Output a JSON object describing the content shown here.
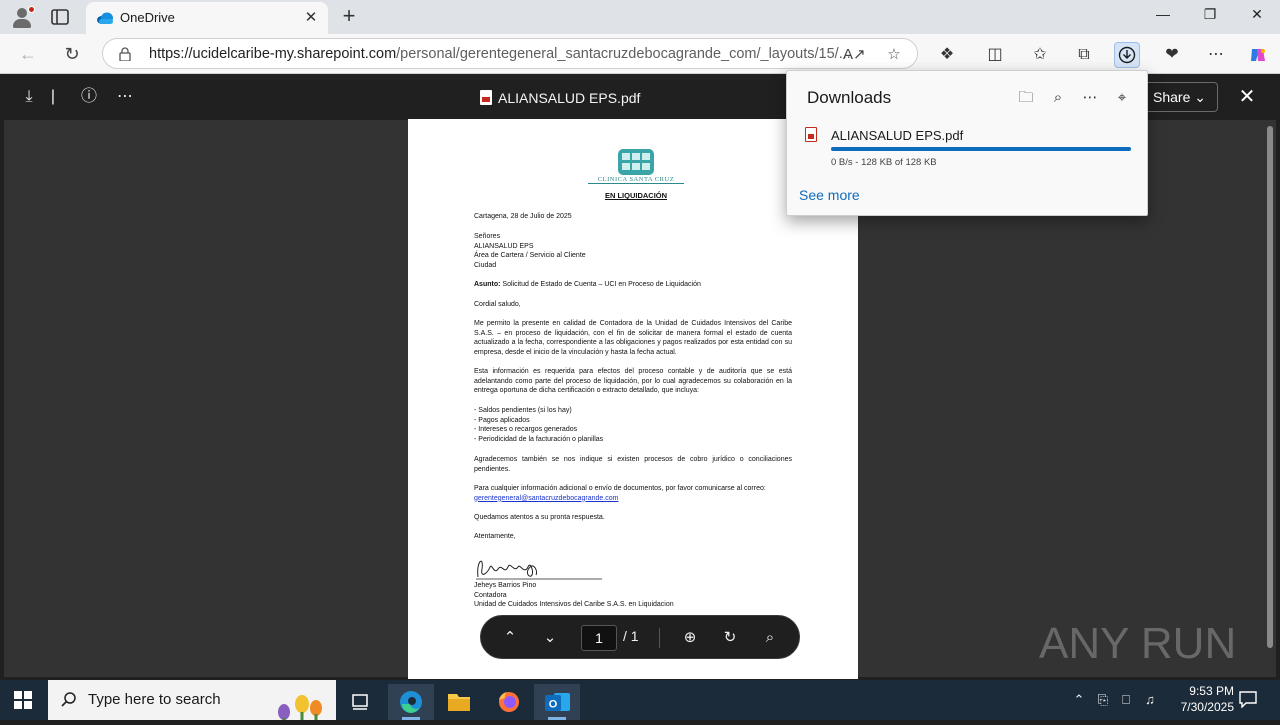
{
  "browser": {
    "tab_title": "OneDrive",
    "new_tab_label": "+",
    "url_host": "https://ucidelcaribe-my.sharepoint.com",
    "url_path": "/personal/gerentegeneral_santacruzdebocagrande_com/_layouts/15/...",
    "window_controls": {
      "minimize": "—",
      "maximize": "❐",
      "close": "✕"
    }
  },
  "viewer": {
    "file_name": "ALIANSALUD EPS.pdf",
    "share_label": "Share",
    "page_current": "1",
    "page_total": "/ 1"
  },
  "document": {
    "logo_text": "CLINICA SANTA CRUZ",
    "heading": "EN LIQUIDACIÓN",
    "date_line": "Cartagena, 28 de Julio de 2025",
    "recipient": [
      "Señores",
      "ALIANSALUD EPS",
      "Área de Cartera / Servicio al Cliente",
      "Ciudad"
    ],
    "subject_label": "Asunto:",
    "subject": " Solicitud de Estado de Cuenta – UCI en Proceso de Liquidación",
    "greeting": "Cordial saludo,",
    "paragraph1": "Me permito la presente en calidad de Contadora de la Unidad de Cuidados Intensivos del Caribe S.A.S. – en proceso de liquidación, con el fin de solicitar de manera formal el estado de cuenta actualizado a la fecha, correspondiente a las obligaciones y pagos realizados por esta entidad con su empresa, desde el inicio de la vinculación y hasta la fecha actual.",
    "paragraph2": "Esta información es requerida para efectos del proceso contable y de auditoría que se está adelantando como parte del proceso de liquidación, por lo cual agradecemos su colaboración en la entrega oportuna de dicha certificación o extracto detallado, que incluya:",
    "list_items": [
      "- Saldos pendientes (si los hay)",
      "- Pagos aplicados",
      "- Intereses o recargos generados",
      "- Periodicidad de la facturación o planillas"
    ],
    "paragraph3": "Agradecemos también se nos indique si existen procesos de cobro jurídico o conciliaciones pendientes.",
    "paragraph4": "Para cualquier información adicional o envío de documentos, por favor comunicarse al correo:",
    "email": "gerentegeneral@santacruzdebocagrande.com",
    "closing_line": "Quedamos atentos a su pronta respuesta.",
    "sign_off": "Atentamente,",
    "signer_name": "Jeheys Barrios Pino",
    "signer_role": "Contadora",
    "signer_org": "Unidad de Cuidados Intensivos del Caribe S.A.S. en Liquidacion"
  },
  "downloads": {
    "title": "Downloads",
    "file_name": "ALIANSALUD EPS.pdf",
    "status": "0 B/s - 128 KB of 128 KB",
    "progress_percent": 100,
    "see_more": "See more"
  },
  "taskbar": {
    "search_placeholder": "Type here to search",
    "time": "9:53 PM",
    "date": "7/30/2025"
  },
  "watermark_text": "ANY RUN",
  "colors": {
    "accent": "#0f6cbd",
    "pdf_red": "#c42b1c",
    "logo_teal": "#2a8a8e",
    "taskbar": "#1c2b39"
  }
}
